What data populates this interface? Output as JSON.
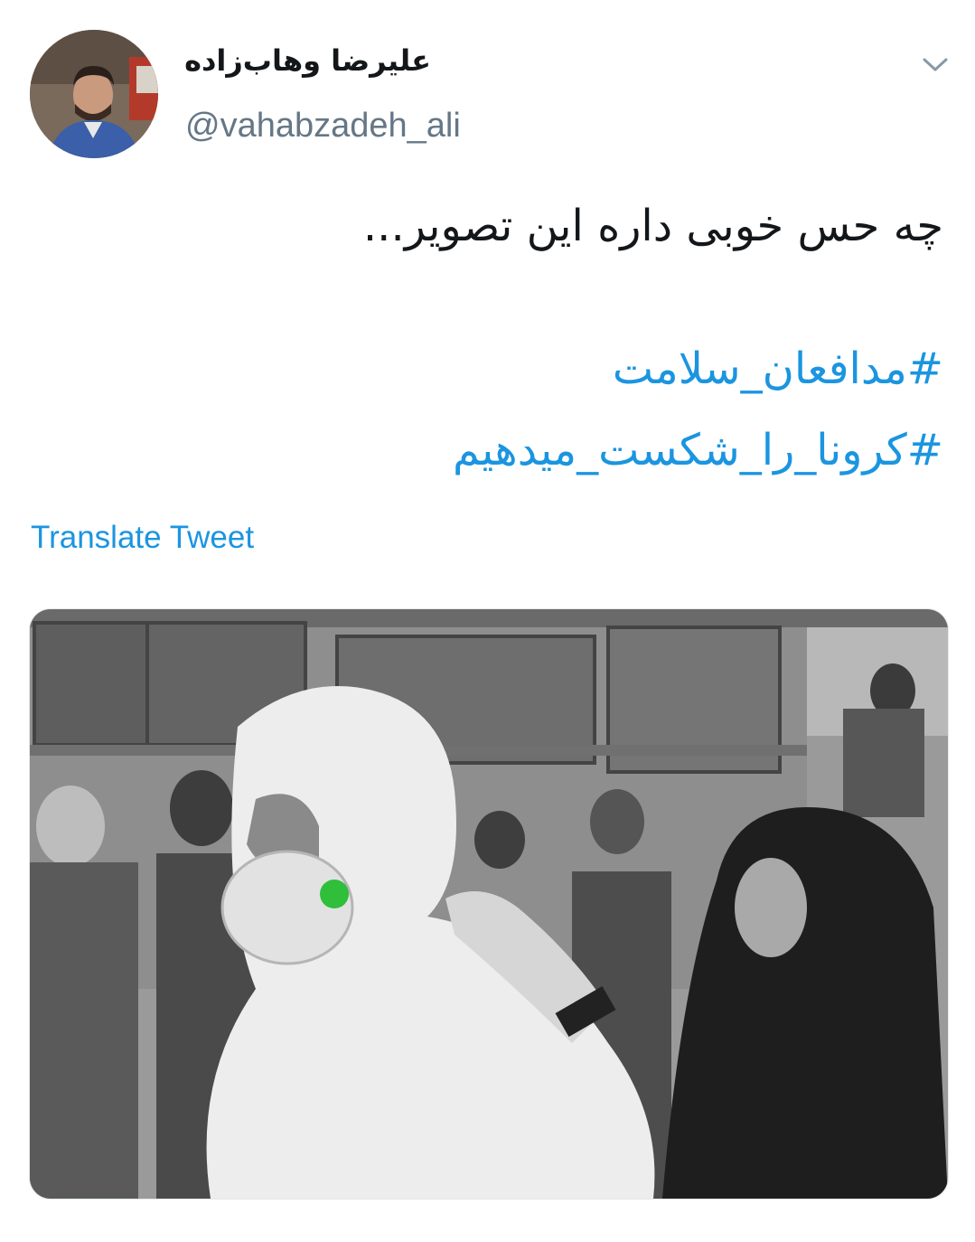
{
  "tweet": {
    "display_name": "علیرضا وهاب‌زاده",
    "handle": "@vahabzadeh_ali",
    "text": "چه حس خوبی داره این تصویر...",
    "hashtags": [
      "#مدافعان_سلامت",
      "#کرونا_را_شکست_میدهیم"
    ],
    "translate_label": "Translate Tweet"
  },
  "icons": {
    "menu": "chevron-down-icon"
  },
  "colors": {
    "link": "#1b95e0",
    "text": "#14171a",
    "secondary": "#657786"
  }
}
